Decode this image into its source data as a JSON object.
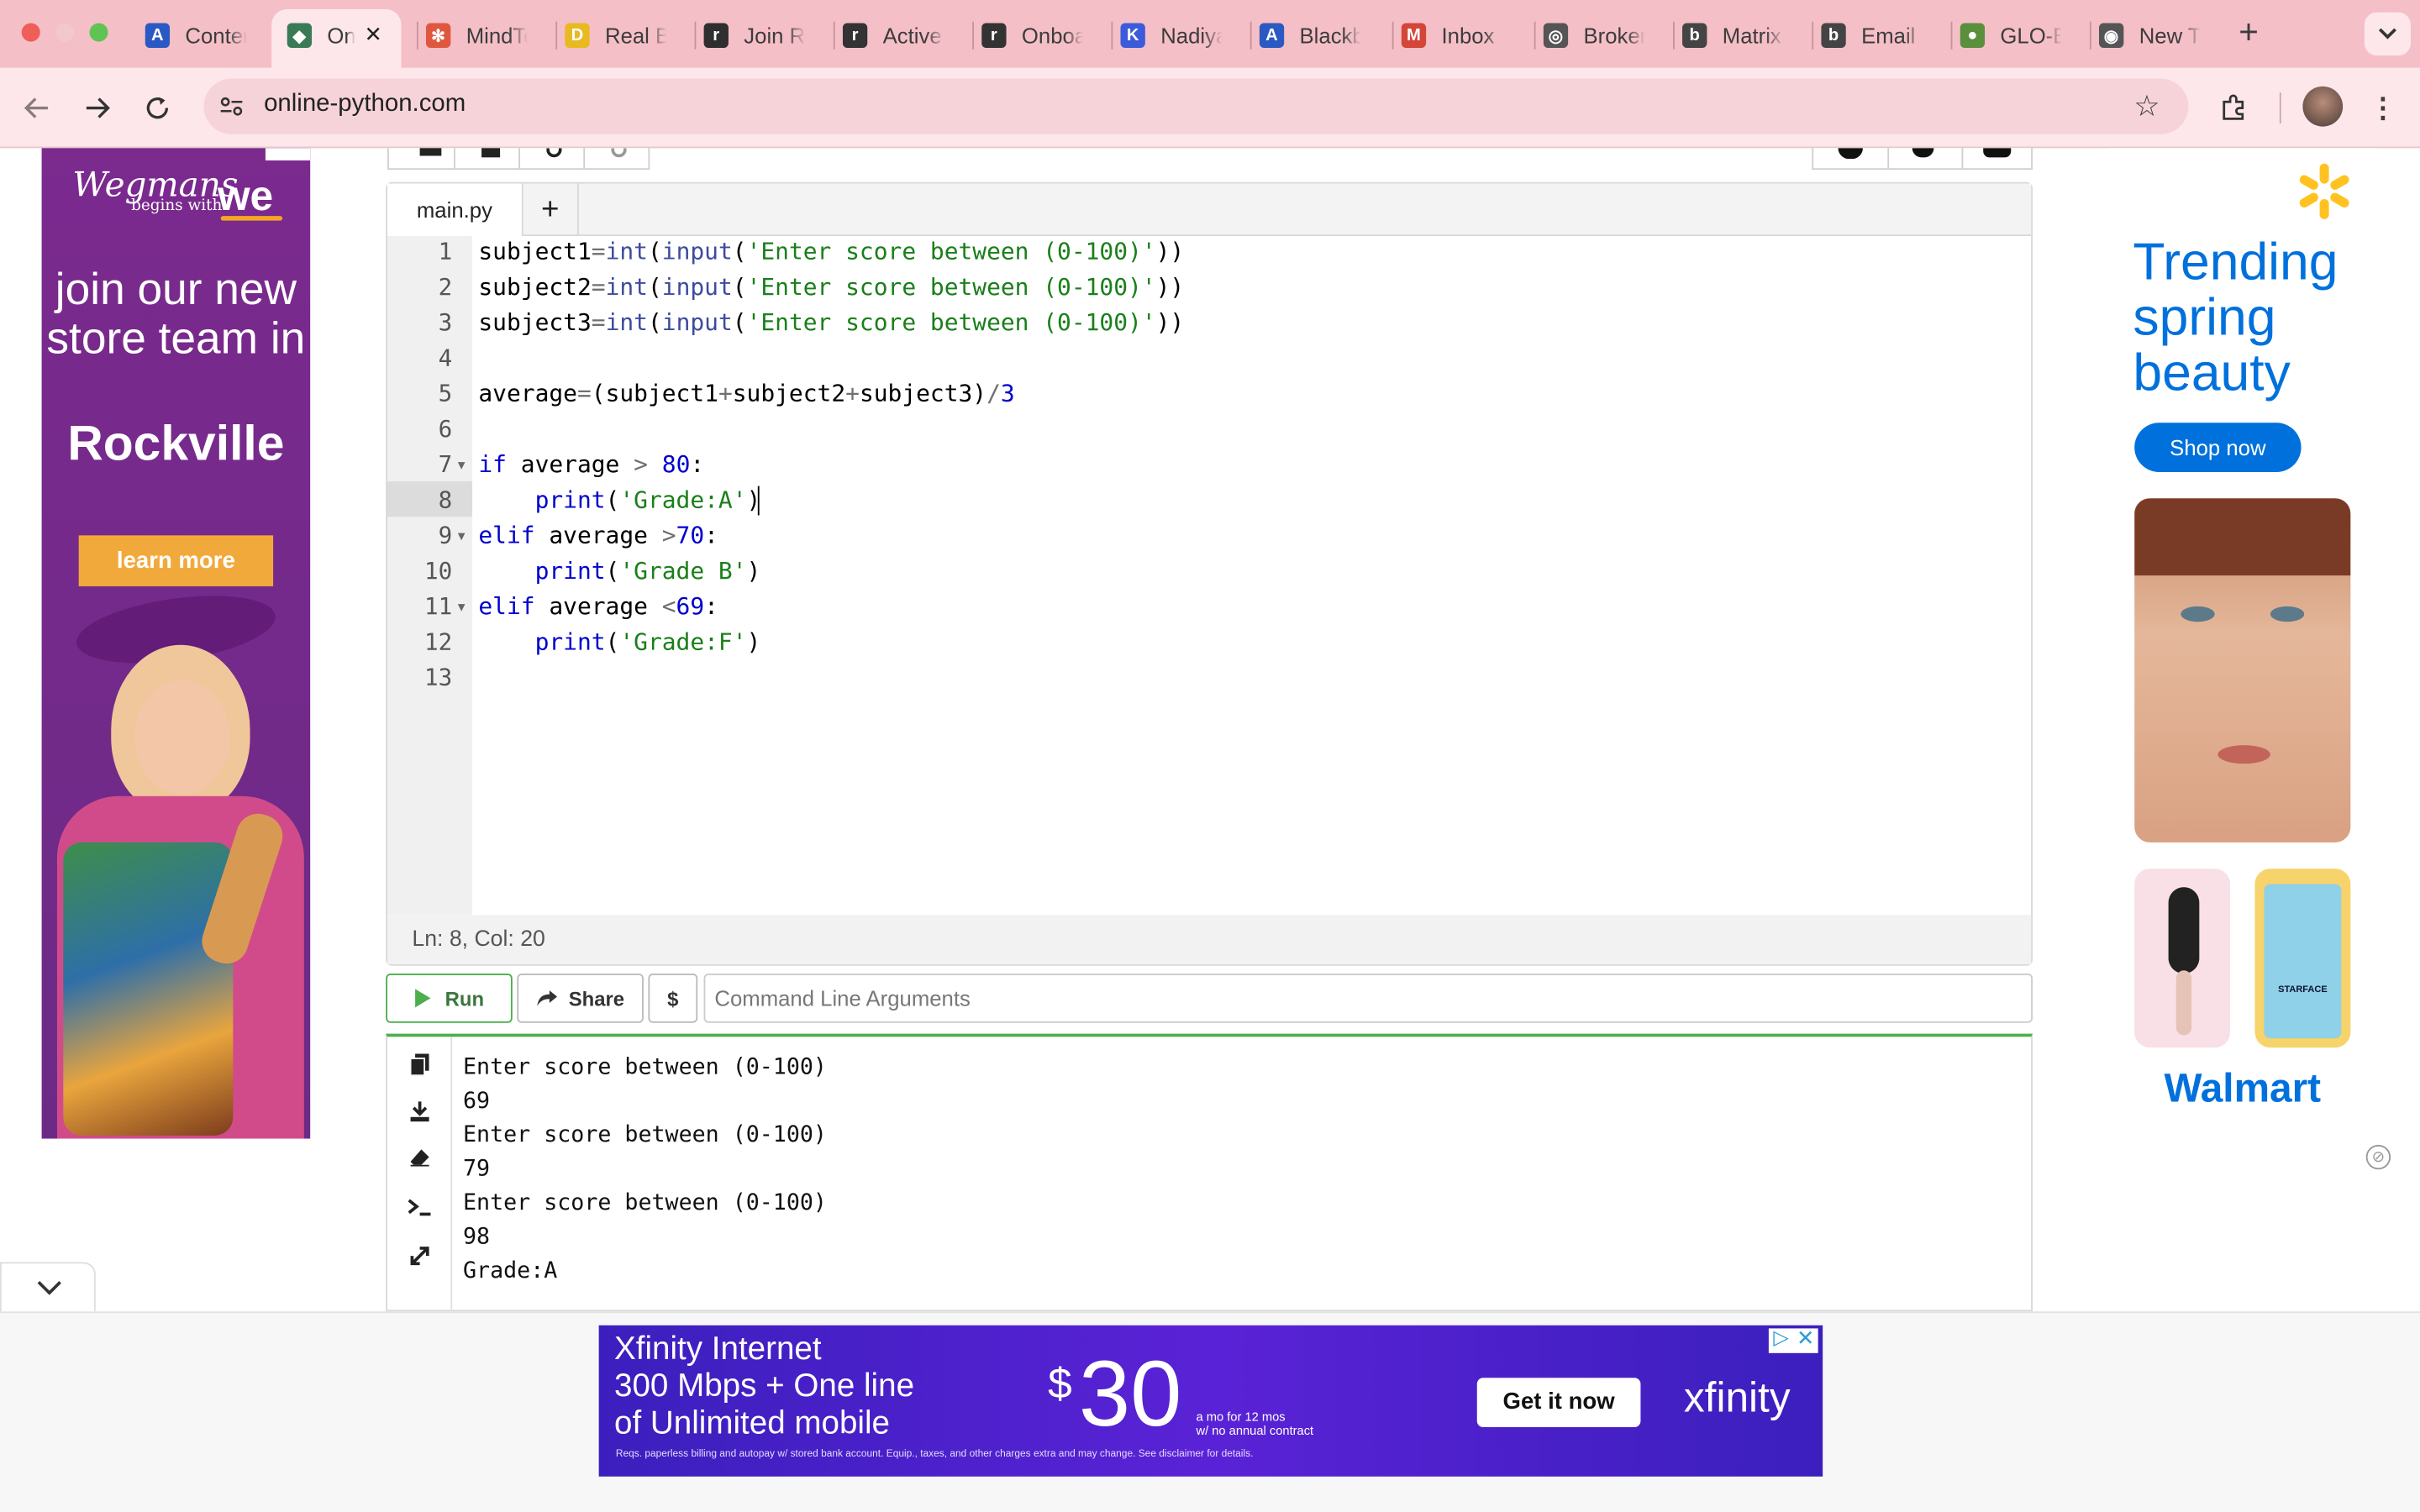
{
  "browser": {
    "tabs": [
      {
        "label": "Content",
        "fav_color": "#2b59c3",
        "fav_glyph": "A"
      },
      {
        "label": "Online",
        "fav_color": "#3b7a57",
        "fav_glyph": "◆"
      },
      {
        "label": "MindTools",
        "fav_color": "#e0573f",
        "fav_glyph": "✻"
      },
      {
        "label": "Real Brokerage",
        "fav_color": "#e8b920",
        "fav_glyph": "D"
      },
      {
        "label": "Join Real",
        "fav_color": "#2f2f2f",
        "fav_glyph": "r"
      },
      {
        "label": "Active",
        "fav_color": "#333333",
        "fav_glyph": "r"
      },
      {
        "label": "Onboarding",
        "fav_color": "#333333",
        "fav_glyph": "r"
      },
      {
        "label": "Nadiya",
        "fav_color": "#3b5bdb",
        "fav_glyph": "K"
      },
      {
        "label": "Blackboard",
        "fav_color": "#2b59c3",
        "fav_glyph": "A"
      },
      {
        "label": "Inbox",
        "fav_color": "#d44638",
        "fav_glyph": "M"
      },
      {
        "label": "Brokerage",
        "fav_color": "#555555",
        "fav_glyph": "◎"
      },
      {
        "label": "Matrix",
        "fav_color": "#444444",
        "fav_glyph": "b"
      },
      {
        "label": "Email",
        "fav_color": "#444444",
        "fav_glyph": "b"
      },
      {
        "label": "GLO-Bus",
        "fav_color": "#5a8f3d",
        "fav_glyph": "●"
      },
      {
        "label": "New Tab",
        "fav_color": "#555555",
        "fav_glyph": "◉"
      }
    ],
    "url": "online-python.com"
  },
  "editor": {
    "file_tab": "main.py",
    "add_tab": "+",
    "line_numbers": [
      "1",
      "2",
      "3",
      "4",
      "5",
      "6",
      "7",
      "8",
      "9",
      "10",
      "11",
      "12",
      "13"
    ],
    "status": "Ln: 8,  Col: 20"
  },
  "runbar": {
    "run": "Run",
    "share": "Share",
    "dollar": "$",
    "args_placeholder": "Command Line Arguments"
  },
  "console": {
    "lines": [
      "Enter score between (0-100)",
      "69",
      "Enter score between (0-100)",
      "79",
      "Enter score between (0-100)",
      "98",
      "Grade:A"
    ]
  },
  "ads": {
    "left": {
      "brand": "Wegmans",
      "brand_sub": "begins with",
      "brand_we": "we",
      "headline": "join our new store team in",
      "city": "Rockville",
      "cta": "learn more"
    },
    "right": {
      "headline": "Trending spring beauty",
      "cta": "Shop now",
      "product_label": "STARFACE",
      "brand": "Walmart"
    },
    "bottom": {
      "line1": "Xfinity Internet",
      "line2": "300 Mbps + One line",
      "line3": "of Unlimited mobile",
      "currency": "$",
      "price": "30",
      "price_note1": "a mo for 12 mos",
      "price_note2": "w/ no annual contract",
      "cta": "Get it now",
      "brand": "xfinity",
      "disclaimer": "Reqs. paperless billing and autopay w/ stored bank account. Equip., taxes, and other charges extra and may change. See disclaimer for details."
    }
  }
}
